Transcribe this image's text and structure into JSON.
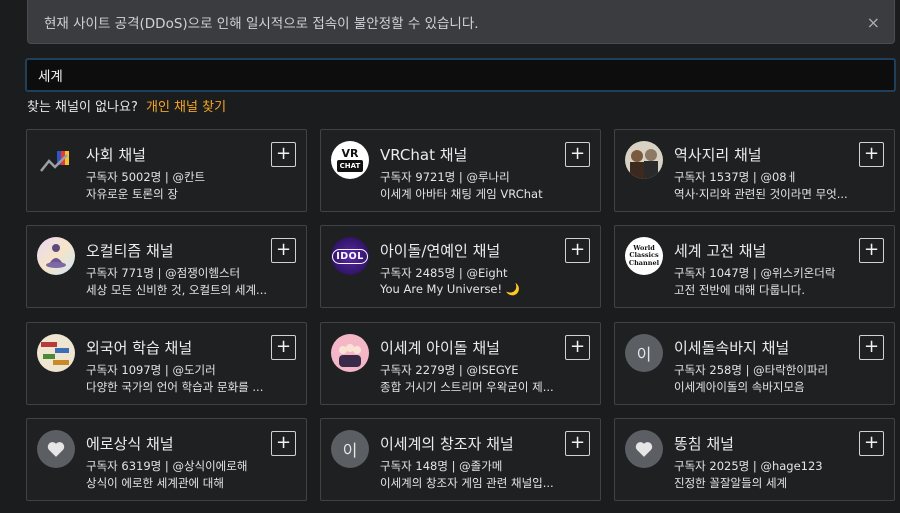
{
  "notice": {
    "text": "현재 사이트 공격(DDoS)으로 인해 일시적으로 접속이 불안정할 수 있습니다.",
    "close_glyph": "×"
  },
  "search": {
    "value": "세계"
  },
  "find_prompt": {
    "text": "찾는 채널이 없나요?",
    "link": "개인 채널 찾기"
  },
  "add_glyph": "+",
  "colors": {
    "accent": "#f5a623",
    "card_bg": "#1f2021",
    "card_border": "#404245",
    "page_bg": "#1b1c1d"
  },
  "channels": [
    {
      "title": "사회 채널",
      "subscribers": "구독자 5002명",
      "handle": "@칸트",
      "description": "자유로운 토론의 장",
      "avatar_icon": "flag-chart-icon"
    },
    {
      "title": "VRChat 채널",
      "subscribers": "구독자 9721명",
      "handle": "@루나리",
      "description": "이세계 아바타 채팅 게임 VRChat",
      "avatar_icon": "vrchat-logo",
      "avatar_text_1": "VR",
      "avatar_text_2": "CHAT"
    },
    {
      "title": "역사지리 채널",
      "subscribers": "구독자 1537명",
      "handle": "@08ㅔ",
      "description": "역사·지리와 관련된 것이라면 무엇...",
      "avatar_icon": "historical-portrait-icon"
    },
    {
      "title": "오컬티즘 채널",
      "subscribers": "구독자 771명",
      "handle": "@점쟁이헴스터",
      "description": "세상 모든 신비한 것, 오컬트의 세계...",
      "avatar_icon": "meditation-figure-icon"
    },
    {
      "title": "아이돌/연예인 채널",
      "subscribers": "구독자 2485명",
      "handle": "@Eight",
      "description": "You Are My Universe! 🌙",
      "avatar_icon": "idol-logo",
      "avatar_text_1": "IDOL"
    },
    {
      "title": "세계 고전 채널",
      "subscribers": "구독자 1047명",
      "handle": "@위스키온더락",
      "description": "고전 전반에 대해 다룹니다.",
      "avatar_icon": "world-classics-logo",
      "avatar_text_1": "World",
      "avatar_text_2": "Classics",
      "avatar_text_3": "Channel"
    },
    {
      "title": "외국어 학습 채널",
      "subscribers": "구독자 1097명",
      "handle": "@도기러",
      "description": "다양한 국가의 언어 학습과 문화를 ...",
      "avatar_icon": "language-words-icon"
    },
    {
      "title": "이세계 아이돌 채널",
      "subscribers": "구독자 2279명",
      "handle": "@ISEGYE",
      "description": "종합 거시기 스트리머 우왁굳이 제...",
      "avatar_icon": "idol-group-icon"
    },
    {
      "title": "이세돌속바지 채널",
      "subscribers": "구독자 258명",
      "handle": "@타락한이파리",
      "description": "이세계아이돌의 속바지모음",
      "avatar_icon": "letter-avatar",
      "avatar_text_1": "이"
    },
    {
      "title": "에로상식 채널",
      "subscribers": "구독자 6319명",
      "handle": "@상식이에로해",
      "description": "상식이 에로한 세계관에 대해",
      "avatar_icon": "heart-icon"
    },
    {
      "title": "이세계의 창조자 채널",
      "subscribers": "구독자 148명",
      "handle": "@졸가메",
      "description": "이세계의 창조자 게임 관련 채널입...",
      "avatar_icon": "letter-avatar",
      "avatar_text_1": "이"
    },
    {
      "title": "똥침 채널",
      "subscribers": "구독자 2025명",
      "handle": "@hage123",
      "description": "진정한 꼴잘알들의 세계",
      "avatar_icon": "heart-icon"
    }
  ]
}
